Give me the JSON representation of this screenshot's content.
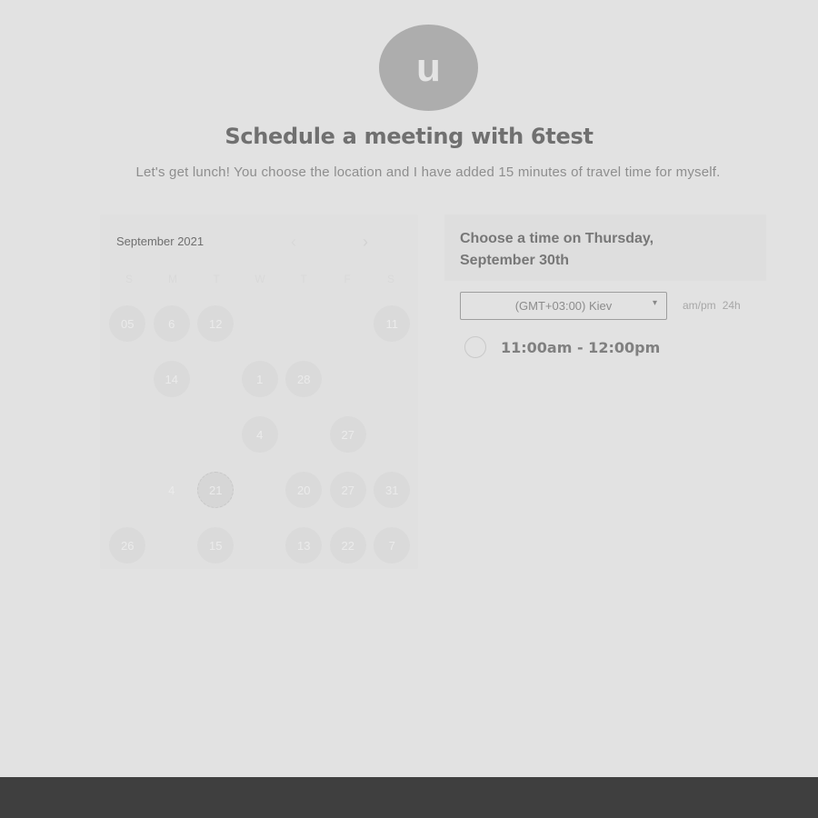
{
  "header": {
    "avatar_letter": "u",
    "title": "Schedule a meeting with 6test",
    "description": "Let's get lunch! You choose the location and I have added 15 minutes of travel time for myself."
  },
  "calendar": {
    "month": "September 2021",
    "prev_icon": "‹",
    "next_icon": "›",
    "weekdays": [
      "S",
      "M",
      "T",
      "W",
      "T",
      "F",
      "S"
    ],
    "days": [
      {
        "label": "05",
        "state": "avail"
      },
      {
        "label": "6",
        "state": "avail"
      },
      {
        "label": "12",
        "state": "avail"
      },
      {
        "label": "",
        "state": "empty"
      },
      {
        "label": "",
        "state": "empty"
      },
      {
        "label": "",
        "state": "empty"
      },
      {
        "label": "11",
        "state": "avail"
      },
      {
        "label": "",
        "state": "empty"
      },
      {
        "label": "14",
        "state": "avail"
      },
      {
        "label": "",
        "state": "empty"
      },
      {
        "label": "1",
        "state": "avail"
      },
      {
        "label": "28",
        "state": "avail"
      },
      {
        "label": "",
        "state": "empty"
      },
      {
        "label": "",
        "state": "empty"
      },
      {
        "label": "",
        "state": "empty"
      },
      {
        "label": "",
        "state": "empty"
      },
      {
        "label": "",
        "state": "empty"
      },
      {
        "label": "4",
        "state": "avail"
      },
      {
        "label": "",
        "state": "empty"
      },
      {
        "label": "27",
        "state": "avail"
      },
      {
        "label": "",
        "state": "empty"
      },
      {
        "label": "",
        "state": "empty"
      },
      {
        "label": "4",
        "state": "plain"
      },
      {
        "label": "21",
        "state": "selected"
      },
      {
        "label": "",
        "state": "empty"
      },
      {
        "label": "20",
        "state": "avail"
      },
      {
        "label": "27",
        "state": "avail"
      },
      {
        "label": "31",
        "state": "avail"
      },
      {
        "label": "26",
        "state": "avail"
      },
      {
        "label": "",
        "state": "empty"
      },
      {
        "label": "15",
        "state": "avail"
      },
      {
        "label": "",
        "state": "empty"
      },
      {
        "label": "13",
        "state": "avail"
      },
      {
        "label": "22",
        "state": "avail"
      },
      {
        "label": "7",
        "state": "avail"
      }
    ]
  },
  "panel": {
    "title": "Choose a time on Thursday, September 30th"
  },
  "timezone": {
    "selected": "(GMT+03:00) Kiev",
    "caret": "▾"
  },
  "format": {
    "ampm": "am/pm",
    "h24": "24h"
  },
  "slots": [
    {
      "label": "11:00am - 12:00pm"
    }
  ]
}
